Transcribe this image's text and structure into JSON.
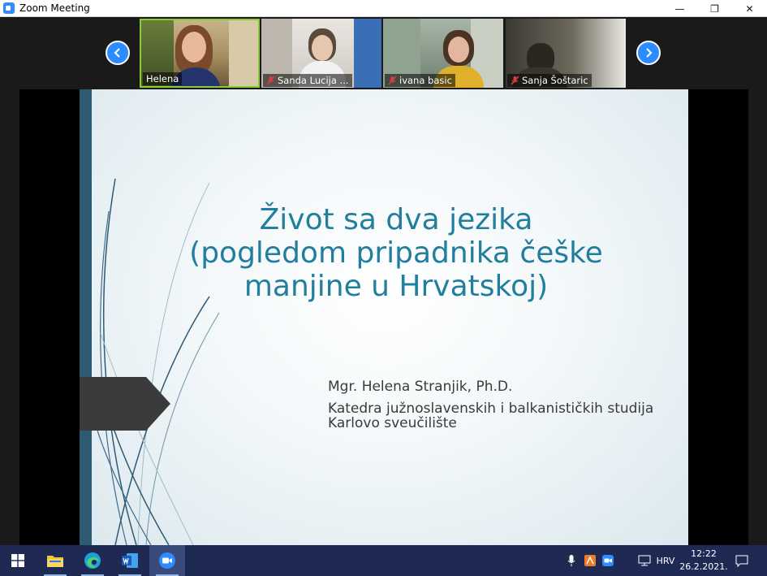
{
  "window": {
    "title": "Zoom Meeting",
    "controls": {
      "minimize": "—",
      "restore": "❐",
      "close": "✕"
    }
  },
  "gallery": {
    "participants": [
      {
        "name": "Helena",
        "muted": false,
        "active": true
      },
      {
        "name": "Sanda Lucija ...",
        "muted": true,
        "active": false
      },
      {
        "name": "ivana basic",
        "muted": true,
        "active": false
      },
      {
        "name": "Sanja Šoštaric",
        "muted": true,
        "active": false
      }
    ]
  },
  "slide": {
    "title_lines": [
      "Život sa dva jezika",
      "(pogledom pripadnika češke",
      "manjine u Hrvatskoj)"
    ],
    "author": "Mgr. Helena Stranjik, Ph.D.",
    "affiliation_lines": [
      "Katedra južnoslavenskih i balkanističkih studija",
      "Karlovo sveučilište"
    ]
  },
  "taskbar": {
    "language": "HRV",
    "time": "12:22",
    "date": "26.2.2021."
  },
  "colors": {
    "zoom_blue": "#2D8CFF",
    "slide_title": "#217e9c",
    "slide_bar": "#2e5a74",
    "taskbar": "#1f2a54",
    "active_speaker": "#8acb3c"
  }
}
